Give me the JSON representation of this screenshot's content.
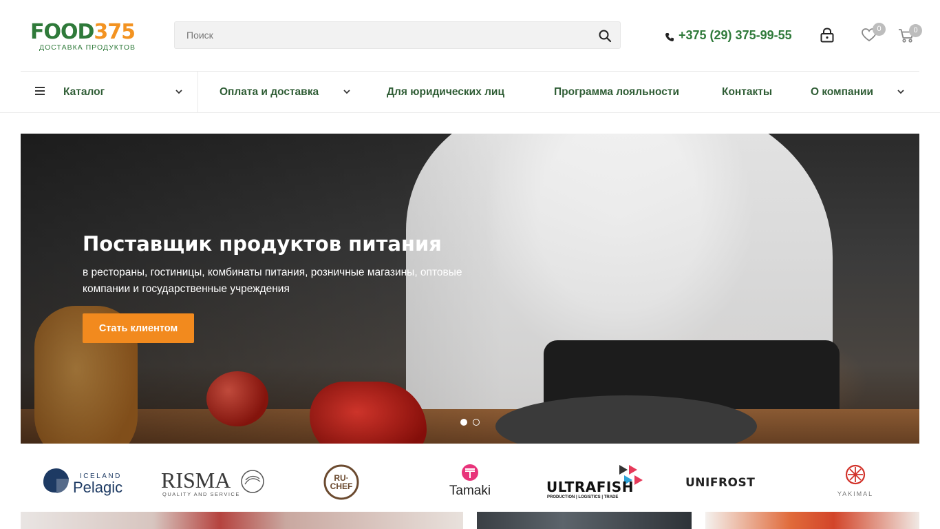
{
  "header": {
    "logo_text_main": "FOOD",
    "logo_text_num": "375",
    "logo_tagline": "ДОСТАВКА ПРОДУКТОВ",
    "search_placeholder": "Поиск",
    "phone": "+375 (29) 375-99-55",
    "wishlist_count": "0",
    "cart_count": "0"
  },
  "nav": {
    "catalog": "Каталог",
    "items": [
      {
        "label": "Оплата и доставка",
        "has_dropdown": true
      },
      {
        "label": "Для юридических лиц",
        "has_dropdown": false
      },
      {
        "label": "Программа лояльности",
        "has_dropdown": false
      },
      {
        "label": "Контакты",
        "has_dropdown": false
      },
      {
        "label": "О компании",
        "has_dropdown": true
      }
    ]
  },
  "hero": {
    "title": "Поставщик продуктов питания",
    "subtitle": "в рестораны, гостиницы, комбинаты питания, розничные магазины, оптовые компании и государственные учреждения",
    "button": "Стать клиентом",
    "slides_total": 2,
    "active_slide": 1
  },
  "brands": [
    {
      "name": "Iceland Pelagic",
      "line1": "ICELAND",
      "line2": "Pelagic"
    },
    {
      "name": "RISMA",
      "line1": "RISMA",
      "line2": "QUALITY AND SERVICE"
    },
    {
      "name": "RU-CHEF",
      "line1": "RU·",
      "line2": "CHEF"
    },
    {
      "name": "Tamaki",
      "line1": "Tamaki"
    },
    {
      "name": "ULTRAFISH",
      "line1": "ULTRAFISH",
      "line2": "PRODUCTION | LOGISTICS | TRADE"
    },
    {
      "name": "UNIFROST",
      "line1": "UNIFROST"
    },
    {
      "name": "YAKIMAL",
      "line1": "YAKIMAL"
    }
  ],
  "colors": {
    "brand_green": "#2f7a3a",
    "nav_green": "#2f5d35",
    "accent_orange": "#f28a1e",
    "badge_gray": "#bdbdbd"
  },
  "icons": {
    "search": "search-icon",
    "phone": "phone-icon",
    "account": "lock-icon",
    "wishlist": "heart-icon",
    "cart": "cart-icon",
    "menu": "burger-menu-icon",
    "dropdown": "chevron-down-icon"
  }
}
